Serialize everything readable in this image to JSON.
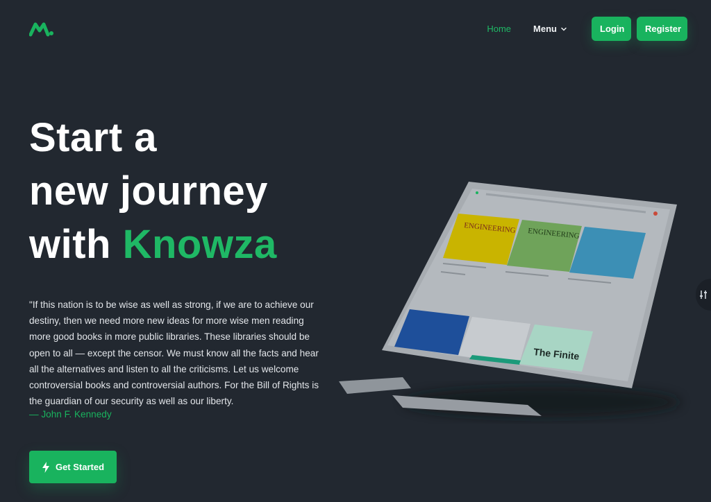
{
  "nav": {
    "home": "Home",
    "menu": "Menu",
    "login": "Login",
    "register": "Register"
  },
  "hero": {
    "line1": "Start a",
    "line2": "new journey",
    "line3_prefix": "with ",
    "line3_accent": "Knowza",
    "quote": "\"If this nation is to be wise as well as strong, if we are to achieve our destiny, then we need more new ideas for more wise men reading more good books in more public libraries. These libraries should be open to all — except the censor. We must know all the facts and hear all the alternatives and listen to all the criticisms. Let us welcome controversial books and controversial authors. For the Bill of Rights is the guardian of our security as well as our liberty.",
    "author": "— John F. Kennedy",
    "cta": "Get Started"
  },
  "device": {
    "book1": "ENGINEERING",
    "book2": "ENGINEERING",
    "book6": "The Finite"
  },
  "colors": {
    "accent": "#19b35e",
    "background": "#222830"
  },
  "icons": {
    "logo": "knowza-logo",
    "menu_chevron": "chevron-down-icon",
    "cta": "lightning-bolt-icon",
    "side": "sliders-icon"
  }
}
